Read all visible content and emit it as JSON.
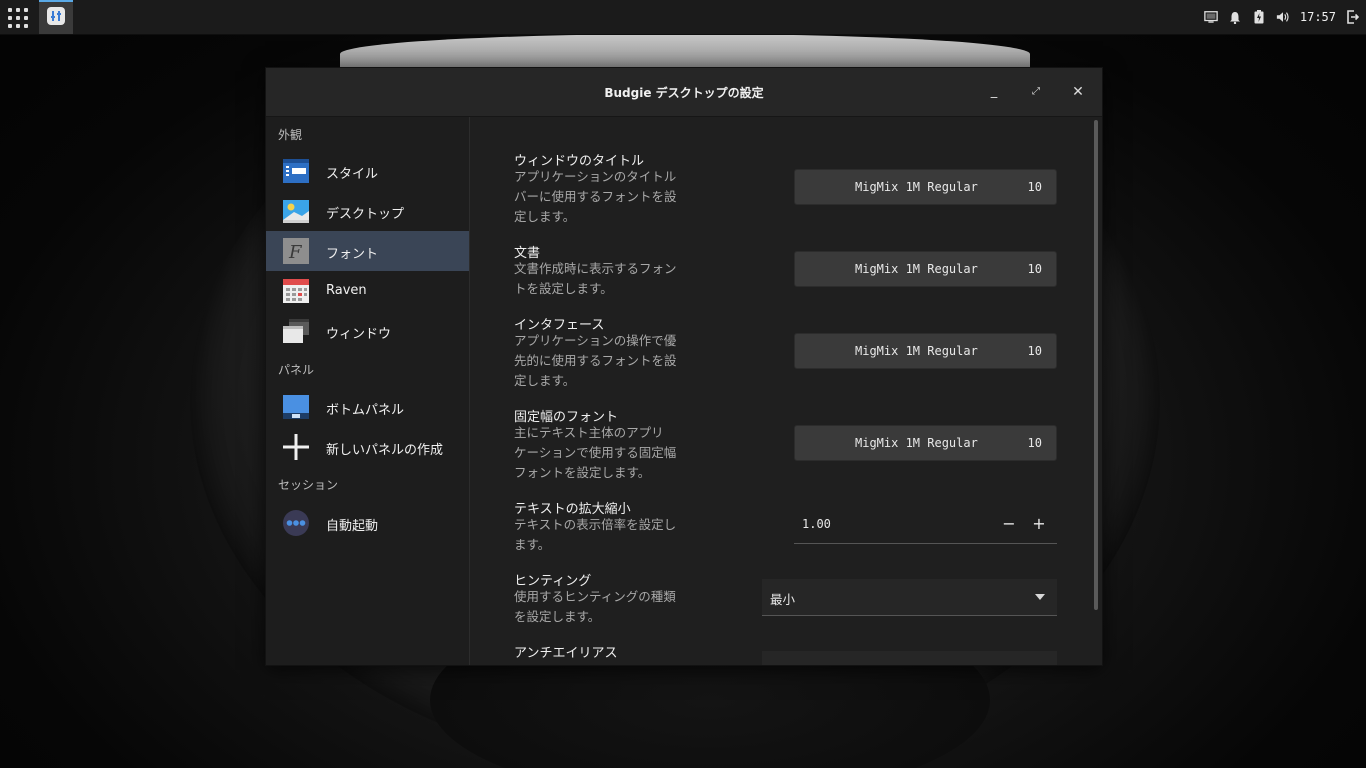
{
  "panel": {
    "clock": "17:57",
    "tray_icons": [
      "display-icon",
      "bell-icon",
      "battery-icon",
      "volume-icon",
      "logout-icon"
    ]
  },
  "window": {
    "title": "Budgie デスクトップの設定",
    "buttons": {
      "minimize": "_",
      "maximize": "⤢",
      "close": "✕"
    }
  },
  "sidebar": {
    "sections": [
      {
        "title": "外観"
      },
      {
        "title": "パネル"
      },
      {
        "title": "セッション"
      }
    ],
    "items": [
      {
        "label": "スタイル",
        "icon": "style-icon"
      },
      {
        "label": "デスクトップ",
        "icon": "desktop-icon"
      },
      {
        "label": "フォント",
        "icon": "font-icon",
        "active": true
      },
      {
        "label": "Raven",
        "icon": "calendar-icon"
      },
      {
        "label": "ウィンドウ",
        "icon": "windows-icon"
      },
      {
        "label": "ボトムパネル",
        "icon": "panel-icon"
      },
      {
        "label": "新しいパネルの作成",
        "icon": "plus-icon"
      },
      {
        "label": "自動起動",
        "icon": "dots-icon"
      }
    ]
  },
  "settings": {
    "rows": [
      {
        "title": "ウィンドウのタイトル",
        "desc": [
          "アプリケーションのタイトル",
          "バーに使用するフォントを設",
          "定します。"
        ],
        "font": "MigMix 1M Regular",
        "size": "10"
      },
      {
        "title": "文書",
        "desc": [
          "文書作成時に表示するフォン",
          "トを設定します。"
        ],
        "font": "MigMix 1M Regular",
        "size": "10"
      },
      {
        "title": "インタフェース",
        "desc": [
          "アプリケーションの操作で優",
          "先的に使用するフォントを設",
          "定します。"
        ],
        "font": "MigMix 1M Regular",
        "size": "10"
      },
      {
        "title": "固定幅のフォント",
        "desc": [
          "主にテキスト主体のアプリ",
          "ケーションで使用する固定幅",
          "フォントを設定します。"
        ],
        "font": "MigMix 1M Regular",
        "size": "10"
      },
      {
        "title": "テキストの拡大縮小",
        "desc": [
          "テキストの表示倍率を設定し",
          "ます。"
        ],
        "value": "1.00",
        "minus": "−",
        "plus": "+"
      },
      {
        "title": "ヒンティング",
        "desc": [
          "使用するヒンティングの種類",
          "を設定します。"
        ],
        "value": "最小"
      },
      {
        "title": "アンチエイリアス",
        "desc": [],
        "value": ""
      }
    ]
  }
}
